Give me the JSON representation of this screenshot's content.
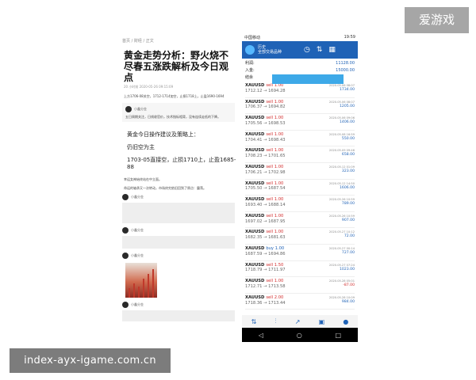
{
  "overlay": {
    "top_badge": "爱游戏",
    "bottom_badge": "index-ayx-igame.com.cn"
  },
  "article": {
    "breadcrumb": "首页 / 财经 / 正文",
    "title": "黄金走势分析：野火烧不尽春五涨跌解析及今日观点",
    "meta": "20 小时前 2020-05-26 09:15:09",
    "summary": "上方1706-08关空，1712-1714加空，止损1718上，止盈1690-1694",
    "user1": "小鑫分金",
    "reply1": "五日周期关注，日线收官价，技术指标相背，没有连续走低的下降。",
    "advice_heading": "黄金今日操作建议及策略上：",
    "advice_1": "仍旧空为主",
    "advice_2": "1703-05直接空，止损1710上，止盈1685-88",
    "comment_line1": "幸运女神始终站在中立面。",
    "comment_line2": "命运的轴承又一次转动，市场终究依旧回到了原点：震荡。"
  },
  "phone": {
    "status_left": "中国移动",
    "status_right": "19:59",
    "app_subtitle": "历史",
    "app_title": "全部交易品种",
    "profit_label": "利润:",
    "profit_value": "11128.00",
    "deposit_label": "入金:",
    "deposit_value": "15000.00",
    "balance_label": "结余",
    "trades": [
      {
        "sym": "XAUUSD",
        "dir": "sell 1.00",
        "px": "1712.12 → 1694.28",
        "date": "2020.05.06 08:07",
        "pl": "1734.00"
      },
      {
        "sym": "XAUUSD",
        "dir": "sell 1.00",
        "px": "1706.37 → 1694.82",
        "date": "2020.05.06 08:07",
        "pl": "1205.00"
      },
      {
        "sym": "XAUUSD",
        "dir": "sell 1.00",
        "px": "1705.56 → 1698.53",
        "date": "2020.05.06 09:06",
        "pl": "1406.00"
      },
      {
        "sym": "XAUUSD",
        "dir": "sell 1.00",
        "px": "1704.41 → 1698.43",
        "date": "2020.05.08 16:59",
        "pl": "550.00"
      },
      {
        "sym": "XAUUSD",
        "dir": "sell 1.00",
        "px": "1708.23 → 1701.65",
        "date": "2020.05.09 09:46",
        "pl": "658.00"
      },
      {
        "sym": "XAUUSD",
        "dir": "sell 1.00",
        "px": "1706.21 → 1702.98",
        "date": "2020.05.12 01:09",
        "pl": "323.00"
      },
      {
        "sym": "XAUUSD",
        "dir": "sell 1.00",
        "px": "1705.50 → 1687.54",
        "date": "2020.05.12 14:50",
        "pl": "1606.00"
      },
      {
        "sym": "XAUUSD",
        "dir": "sell 1.00",
        "px": "1693.40 → 1688.14",
        "date": "2020.05.26 10:59",
        "pl": "789.00"
      },
      {
        "sym": "XAUUSD",
        "dir": "sell 1.00",
        "px": "1697.02 → 1687.95",
        "date": "2020.05.26 10:59",
        "pl": "907.00"
      },
      {
        "sym": "XAUUSD",
        "dir": "sell 1.00",
        "px": "1682.35 → 1681.63",
        "date": "2020.05.27 10:12",
        "pl": "72.00"
      },
      {
        "sym": "XAUUSD",
        "dir": "buy 1.00",
        "px": "1687.59 → 1694.86",
        "date": "2020.05.27 00:14",
        "pl": "727.00"
      },
      {
        "sym": "XAUUSD",
        "dir": "sell 1.50",
        "px": "1718.79 → 1711.97",
        "date": "2020.05.27 07:24",
        "pl": "1023.00"
      },
      {
        "sym": "XAUUSD",
        "dir": "sell 1.00",
        "px": "1712.71 → 1713.58",
        "date": "2020.05.28 05:01",
        "pl": "-87.00"
      },
      {
        "sym": "XAUUSD",
        "dir": "sell 2.00",
        "px": "1718.36 → 1713.44",
        "date": "2020.05.28 10:09",
        "pl": "984.00"
      }
    ],
    "nav_icons": [
      "quotes-icon",
      "chart-icon",
      "trade-icon",
      "history-icon",
      "chat-icon"
    ]
  },
  "colors": {
    "accent": "#1f62b6",
    "sell": "#d32f2f",
    "badge_top": "#a6a6a6",
    "badge_bottom": "#7c7c7c"
  }
}
